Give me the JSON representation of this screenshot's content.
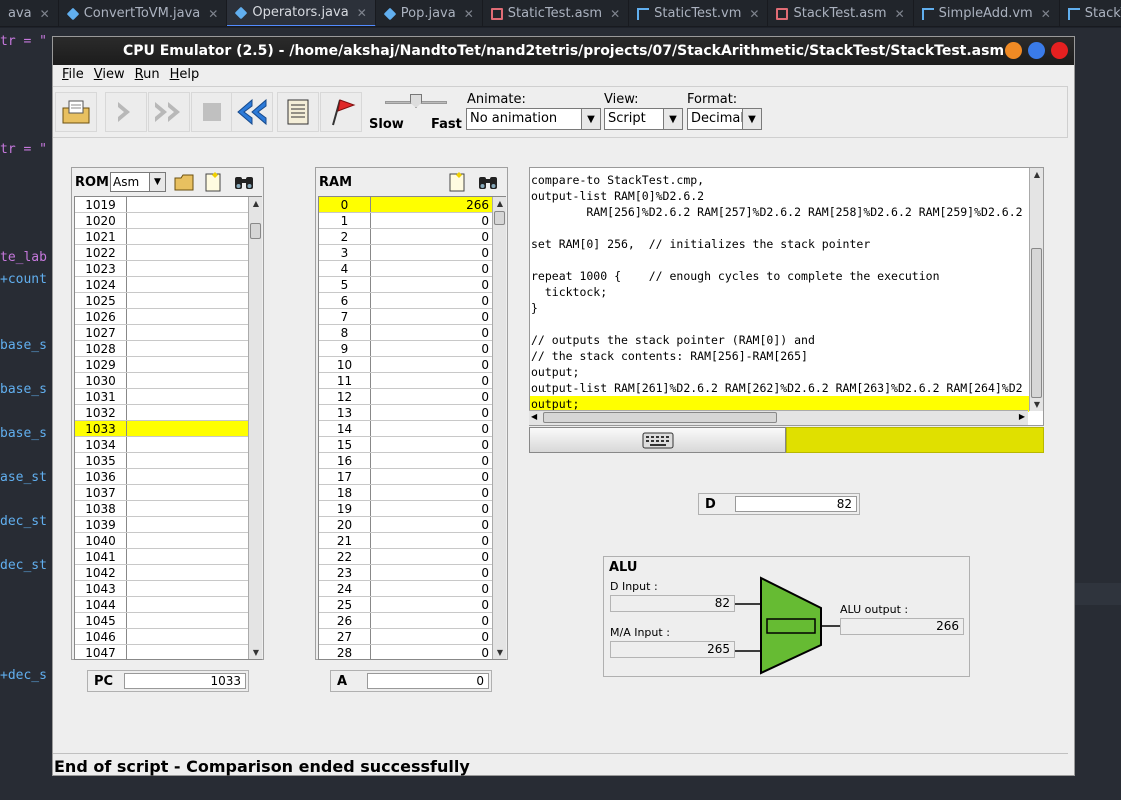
{
  "ide": {
    "tabs": [
      {
        "label": "ava",
        "icon": "none"
      },
      {
        "label": "ConvertToVM.java",
        "icon": "java-icon"
      },
      {
        "label": "Operators.java",
        "icon": "java-icon"
      },
      {
        "label": "Pop.java",
        "icon": "java-icon"
      },
      {
        "label": "StaticTest.asm",
        "icon": "asm-icon"
      },
      {
        "label": "StaticTest.vm",
        "icon": "vm-icon"
      },
      {
        "label": "StackTest.asm",
        "icon": "asm-icon"
      },
      {
        "label": "SimpleAdd.vm",
        "icon": "vm-icon"
      },
      {
        "label": "StackTest.v",
        "icon": "vm-icon"
      }
    ],
    "active_tab": 2,
    "gutter_lines": [
      {
        "text": "tr = \"",
        "style": "purple"
      },
      {
        "text": "tr = \"",
        "style": "purple"
      },
      {
        "text": "te_lab",
        "style": "purple"
      },
      {
        "text": "+count",
        "style": "blue"
      },
      {
        "text": "base_s",
        "style": "blue"
      },
      {
        "text": "base_s",
        "style": "blue"
      },
      {
        "text": "base_s",
        "style": "blue"
      },
      {
        "text": "ase_st",
        "style": "blue"
      },
      {
        "text": "dec_st",
        "style": "blue"
      },
      {
        "text": "dec_st",
        "style": "blue"
      },
      {
        "text": "+dec_s",
        "style": "blue"
      }
    ]
  },
  "window": {
    "title": "CPU Emulator (2.5) - /home/akshaj/NandtoTet/nand2tetris/projects/07/StackArithmetic/StackTest/StackTest.asm"
  },
  "menu": [
    {
      "key": "F",
      "rest": "ile"
    },
    {
      "key": "V",
      "rest": "iew"
    },
    {
      "key": "R",
      "rest": "un"
    },
    {
      "key": "H",
      "rest": "elp"
    }
  ],
  "toolbar": {
    "slow_label": "Slow",
    "fast_label": "Fast",
    "animate_label": "Animate:",
    "animate_value": "No animation",
    "view_label": "View:",
    "view_value": "Script",
    "format_label": "Format:",
    "format_value": "Decimal"
  },
  "rom": {
    "title": "ROM",
    "mode": "Asm",
    "rows": [
      1019,
      1020,
      1021,
      1022,
      1023,
      1024,
      1025,
      1026,
      1027,
      1028,
      1029,
      1030,
      1031,
      1032,
      1033,
      1034,
      1035,
      1036,
      1037,
      1038,
      1039,
      1040,
      1041,
      1042,
      1043,
      1044,
      1045,
      1046,
      1047
    ],
    "selected_row": 1033
  },
  "ram": {
    "title": "RAM",
    "rows": [
      {
        "addr": "0",
        "val": "266"
      },
      {
        "addr": "1",
        "val": "0"
      },
      {
        "addr": "2",
        "val": "0"
      },
      {
        "addr": "3",
        "val": "0"
      },
      {
        "addr": "4",
        "val": "0"
      },
      {
        "addr": "5",
        "val": "0"
      },
      {
        "addr": "6",
        "val": "0"
      },
      {
        "addr": "7",
        "val": "0"
      },
      {
        "addr": "8",
        "val": "0"
      },
      {
        "addr": "9",
        "val": "0"
      },
      {
        "addr": "10",
        "val": "0"
      },
      {
        "addr": "11",
        "val": "0"
      },
      {
        "addr": "12",
        "val": "0"
      },
      {
        "addr": "13",
        "val": "0"
      },
      {
        "addr": "14",
        "val": "0"
      },
      {
        "addr": "15",
        "val": "0"
      },
      {
        "addr": "16",
        "val": "0"
      },
      {
        "addr": "17",
        "val": "0"
      },
      {
        "addr": "18",
        "val": "0"
      },
      {
        "addr": "19",
        "val": "0"
      },
      {
        "addr": "20",
        "val": "0"
      },
      {
        "addr": "21",
        "val": "0"
      },
      {
        "addr": "22",
        "val": "0"
      },
      {
        "addr": "23",
        "val": "0"
      },
      {
        "addr": "24",
        "val": "0"
      },
      {
        "addr": "25",
        "val": "0"
      },
      {
        "addr": "26",
        "val": "0"
      },
      {
        "addr": "27",
        "val": "0"
      },
      {
        "addr": "28",
        "val": "0"
      }
    ],
    "selected_row": "0"
  },
  "script": {
    "lines": [
      "compare-to StackTest.cmp,",
      "output-list RAM[0]%D2.6.2",
      "        RAM[256]%D2.6.2 RAM[257]%D2.6.2 RAM[258]%D2.6.2 RAM[259]%D2.6.2",
      "",
      "set RAM[0] 256,  // initializes the stack pointer",
      "",
      "repeat 1000 {    // enough cycles to complete the execution",
      "  ticktock;",
      "}",
      "",
      "// outputs the stack pointer (RAM[0]) and",
      "// the stack contents: RAM[256]-RAM[265]",
      "output;",
      "output-list RAM[261]%D2.6.2 RAM[262]%D2.6.2 RAM[263]%D2.6.2 RAM[264]%D2",
      "output;"
    ],
    "selected_line": 14
  },
  "registers": {
    "pc_label": "PC",
    "pc": "1033",
    "a_label": "A",
    "a": "0",
    "d_label": "D",
    "d": "82"
  },
  "alu": {
    "title": "ALU",
    "d_input_label": "D Input :",
    "d_input": "82",
    "ma_input_label": "M/A Input :",
    "ma_input": "265",
    "output_label": "ALU output :",
    "output": "266",
    "body_color": "#66bb33"
  },
  "status": "End of script - Comparison ended successfully"
}
